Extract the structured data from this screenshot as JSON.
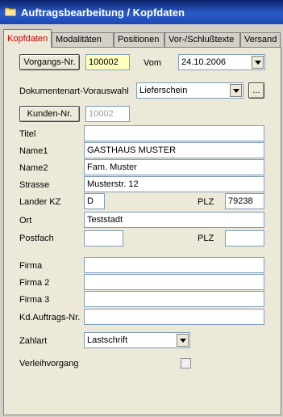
{
  "window": {
    "title": "Auftragsbearbeitung / Kopfdaten",
    "icon": "folder-icon"
  },
  "tabs": [
    "Kopfdaten",
    "Modalitäten",
    "Positionen",
    "Vor-/Schlußtexte",
    "Versand"
  ],
  "header": {
    "vorgang_button": "Vorgangs-Nr.",
    "vorgang_value": "100002",
    "vom_label": "Vom",
    "vom_value": "24.10.2006",
    "dokumentenart_label": "Dokumentenart-Vorauswahl",
    "dokumentenart_value": "Lieferschein",
    "browse_button": "...",
    "kunden_button": "Kunden-Nr.",
    "kunden_value": "10002"
  },
  "form": {
    "titel_label": "Titel",
    "titel_value": "",
    "name1_label": "Name1",
    "name1_value": "GASTHAUS MUSTER",
    "name2_label": "Name2",
    "name2_value": "Fam. Muster",
    "strasse_label": "Strasse",
    "strasse_value": "Musterstr. 12",
    "landerkz_label": "Lander KZ",
    "landerkz_value": "D",
    "plz_label": "PLZ",
    "plz_value": "79238",
    "ort_label": "Ort",
    "ort_value": "Teststadt",
    "postfach_label": "Postfach",
    "postfach_value": "",
    "plz2_label": "PLZ",
    "plz2_value": "",
    "firma_label": "Firma",
    "firma_value": "",
    "firma2_label": "Firma 2",
    "firma2_value": "",
    "firma3_label": "Firma 3",
    "firma3_value": "",
    "kdauftrag_label": "Kd.Auftrags-Nr.",
    "kdauftrag_value": "",
    "zahlart_label": "Zahlart",
    "zahlart_value": "Lastschrift",
    "verleih_label": "Verleihvorgang",
    "verleih_checked": false
  },
  "colors": {
    "active_tab": "#cc0000",
    "titlebar": "#0a246a",
    "highlight_field": "#ffffc0"
  }
}
